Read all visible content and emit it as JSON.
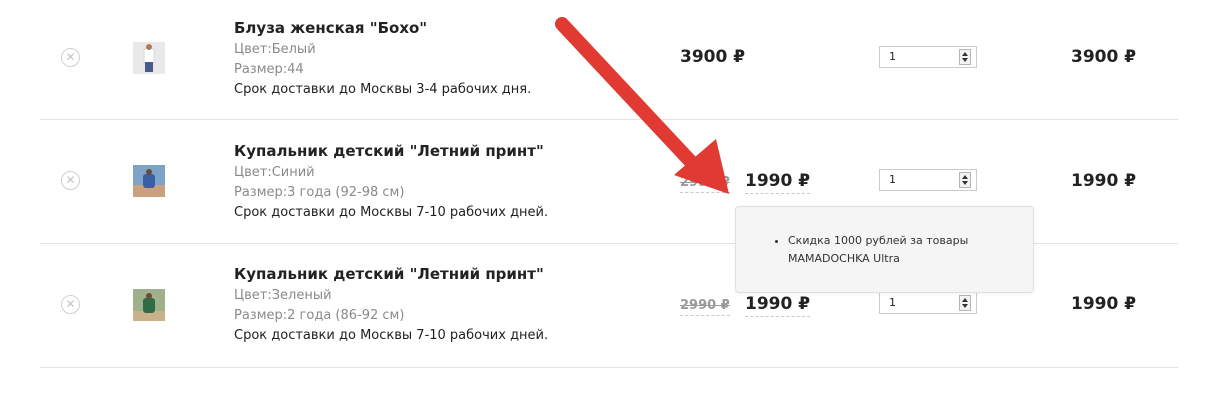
{
  "cart": {
    "currency": "₽",
    "items": [
      {
        "name": "Блуза женская \"Бохо\"",
        "color": "Цвет:Белый",
        "size": "Размер:44",
        "delivery": "Срок доставки до Москвы 3-4 рабочих дня.",
        "price": "3900 ₽",
        "old_price": "",
        "new_price": "",
        "quantity": "1",
        "total": "3900 ₽",
        "thumb_colors": [
          "#e9e9ec",
          "#ffffff",
          "#4a5a8a"
        ]
      },
      {
        "name": "Купальник детский \"Летний принт\"",
        "color": "Цвет:Синий",
        "size": "Размер:3 года (92-98 см)",
        "delivery": "Срок доставки до Москвы 7-10 рабочих дней.",
        "price": "",
        "old_price": "2990 ₽",
        "new_price": "1990 ₽",
        "quantity": "1",
        "total": "1990 ₽",
        "thumb_colors": [
          "#7da3c9",
          "#3a5fa3",
          "#c9a27d"
        ]
      },
      {
        "name": "Купальник детский \"Летний принт\"",
        "color": "Цвет:Зеленый",
        "size": "Размер:2 года (86-92 см)",
        "delivery": "Срок доставки до Москвы 7-10 рабочих дней.",
        "price": "",
        "old_price": "2990 ₽",
        "new_price": "1990 ₽",
        "quantity": "1",
        "total": "1990 ₽",
        "thumb_colors": [
          "#9fb08a",
          "#2f6b45",
          "#c9b28a"
        ]
      }
    ]
  },
  "tooltip": {
    "items": [
      "Скидка 1000 рублей за товары MAMADOCHKA Ultra"
    ]
  },
  "annotation": {
    "arrow_color": "#e03a32"
  },
  "icons": {
    "remove": "close-circle-icon",
    "spinner": "spinner-arrows-icon"
  }
}
